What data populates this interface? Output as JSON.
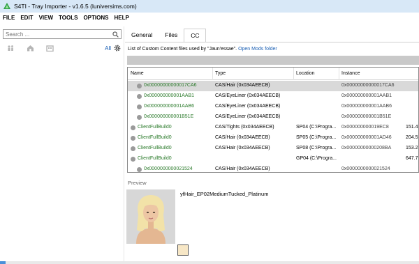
{
  "window": {
    "title": "S4TI - Tray Importer - v1.6.5  (luniversims.com)"
  },
  "menu": [
    "FILE",
    "EDIT",
    "VIEW",
    "TOOLS",
    "OPTIONS",
    "HELP"
  ],
  "search": {
    "placeholder": "Search ..."
  },
  "filters": {
    "all_label": "All",
    "icons": [
      "household-filter-icon",
      "lot-filter-icon",
      "room-filter-icon"
    ]
  },
  "tabs": [
    {
      "label": "General",
      "active": false
    },
    {
      "label": "Files",
      "active": false
    },
    {
      "label": "CC",
      "active": true
    }
  ],
  "cc": {
    "info_text": "List of Custom Content files used by \"Jaun'essae\".",
    "link_text": "Open Mods folder",
    "columns": [
      "Name",
      "Type",
      "Location",
      "Instance"
    ],
    "rows": [
      {
        "name": "0x00000000000017CA6",
        "type": "CAS/Hair (0x034AEECB)",
        "location": "",
        "instance": "0x00000000000017CA6",
        "extra": "",
        "indent": true,
        "selected": true
      },
      {
        "name": "0x000000000001AAB1",
        "type": "CAS/EyeLiner (0x034AEECB)",
        "location": "",
        "instance": "0x000000000001AAB1",
        "extra": "",
        "indent": true,
        "selected": false
      },
      {
        "name": "0x000000000001AAB6",
        "type": "CAS/EyeLiner (0x034AEECB)",
        "location": "",
        "instance": "0x000000000001AAB6",
        "extra": "",
        "indent": true,
        "selected": false
      },
      {
        "name": "0x000000000001B51E",
        "type": "CAS/EyeLiner (0x034AEECB)",
        "location": "",
        "instance": "0x000000000001B51E",
        "extra": "",
        "indent": true,
        "selected": false
      },
      {
        "name": "ClientFullBuild0",
        "type": "CAS/Tights (0x034AEECB)",
        "location": "SP04 (C:\\Progra...",
        "instance": "0x000000000019EC8",
        "extra": "151.4",
        "indent": false,
        "selected": false
      },
      {
        "name": "ClientFullBuild0",
        "type": "CAS/Hair (0x034AEECB)",
        "location": "SP05 (C:\\Progra...",
        "instance": "0x000000000001AD46",
        "extra": "204.5",
        "indent": false,
        "selected": false
      },
      {
        "name": "ClientFullBuild0",
        "type": "CAS/Hair (0x034AEECB)",
        "location": "SP08 (C:\\Progra...",
        "instance": "0x00000000000208BA",
        "extra": "153.2",
        "indent": false,
        "selected": false
      },
      {
        "name": "ClientFullBuild0",
        "type": "",
        "location": "GP04 (C:\\Progra...",
        "instance": "",
        "extra": "647.7",
        "indent": false,
        "selected": false
      },
      {
        "name": "0x0000000000021524",
        "type": "CAS/Hair (0x034AEECB)",
        "location": "",
        "instance": "0x0000000000021524",
        "extra": "",
        "indent": true,
        "selected": false
      }
    ]
  },
  "preview": {
    "label": "Preview",
    "item_name": "yfHair_EP02MediumTucked_Platinum",
    "swatch_color": "#f7e7c6"
  },
  "colors": {
    "link": "#1a5fb4",
    "name_green": "#2a7a2a",
    "titlebar": "#d8e8f7",
    "selected_row": "#d9d9d9"
  }
}
